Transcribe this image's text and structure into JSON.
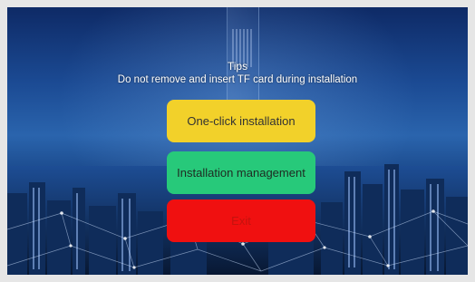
{
  "dialog": {
    "title": "Tips",
    "message": "Do not remove and insert TF card during installation"
  },
  "buttons": {
    "install_label": "One-click installation",
    "manage_label": "Installation management",
    "exit_label": "Exit"
  },
  "colors": {
    "install_button": "#f2d12a",
    "manage_button": "#27c97a",
    "exit_button": "#f01010"
  }
}
